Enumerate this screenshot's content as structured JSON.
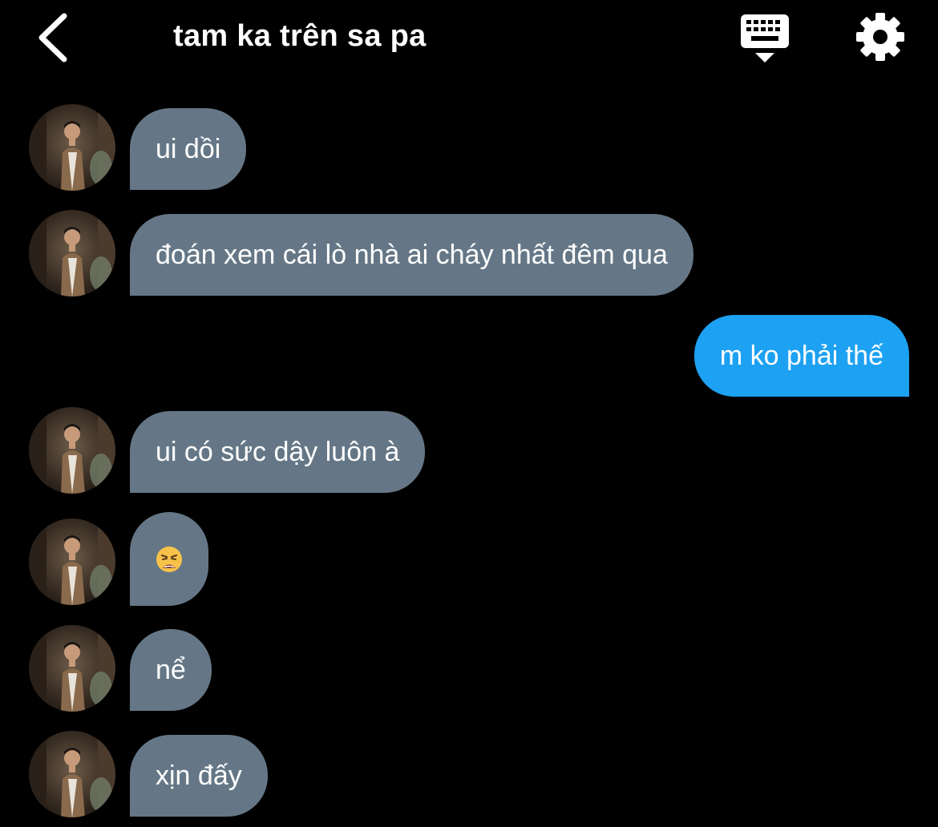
{
  "header": {
    "title": "tam ka trên sa pa",
    "back_icon": "chevron-left-icon",
    "keyboard_icon": "keyboard-icon",
    "settings_icon": "gear-icon"
  },
  "colors": {
    "background": "#000000",
    "incoming_bubble": "#657786",
    "outgoing_bubble": "#1da1f2",
    "text": "#ffffff"
  },
  "messages": [
    {
      "direction": "incoming",
      "text": "ui dồi"
    },
    {
      "direction": "incoming",
      "text": "đoán xem cái lò nhà ai cháy nhất đêm qua"
    },
    {
      "direction": "outgoing",
      "text": "m ko phải thế"
    },
    {
      "direction": "incoming",
      "text": "ui có sức dậy luôn à"
    },
    {
      "direction": "incoming",
      "emoji": "weary-face-emoji"
    },
    {
      "direction": "incoming",
      "text": "nể"
    },
    {
      "direction": "incoming",
      "text": "xịn đấy"
    }
  ]
}
